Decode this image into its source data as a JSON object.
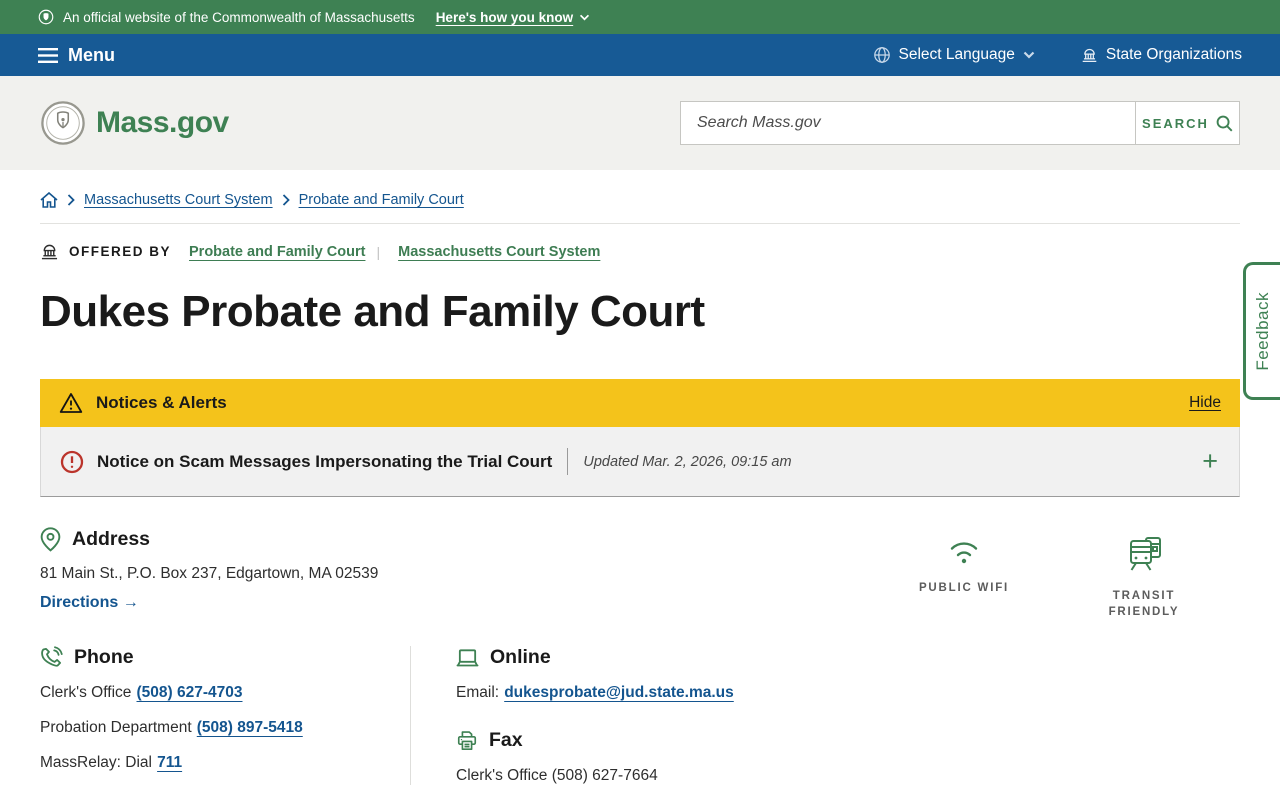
{
  "banner": {
    "official_text": "An official website of the Commonwealth of Massachusetts",
    "how_you_know": "Here's how you know"
  },
  "nav": {
    "menu_label": "Menu",
    "select_language_label": "Select Language",
    "state_organizations_label": "State Organizations"
  },
  "header": {
    "logo_text": "Mass.gov",
    "search_placeholder": "Search Mass.gov",
    "search_button_label": "SEARCH"
  },
  "breadcrumb": {
    "links": [
      {
        "label": "Massachusetts Court System"
      },
      {
        "label": "Probate and Family Court"
      }
    ]
  },
  "offered_by": {
    "label": "OFFERED BY",
    "links": [
      {
        "label": "Probate and Family Court"
      },
      {
        "label": "Massachusetts Court System"
      }
    ]
  },
  "page_title": "Dukes Probate and Family Court",
  "alerts": {
    "header_label": "Notices & Alerts",
    "hide_label": "Hide",
    "notice_title": "Notice on Scam Messages Impersonating the Trial Court",
    "notice_updated": "Updated Mar. 2, 2026, 09:15 am",
    "expand_glyph": "+"
  },
  "address": {
    "heading": "Address",
    "text": "81 Main St., P.O. Box 237, Edgartown, MA 02539",
    "directions_label": "Directions →"
  },
  "features": {
    "wifi_label": "PUBLIC WIFI",
    "transit_label": "TRANSIT FRIENDLY"
  },
  "phone": {
    "heading": "Phone",
    "rows": [
      {
        "label": "Clerk's Office",
        "link": "(508) 627-4703"
      },
      {
        "label": "Probation Department",
        "link": "(508) 897-5418"
      },
      {
        "label": "MassRelay: Dial",
        "link": "711"
      }
    ]
  },
  "online": {
    "heading": "Online",
    "email_label": "Email:",
    "email_link": "dukesprobate@jud.state.ma.us"
  },
  "fax": {
    "heading": "Fax",
    "text": "Clerk's Office (508) 627-7664"
  },
  "feedback_label": "Feedback",
  "colors": {
    "banner_green": "#3E8153",
    "nav_blue": "#175A95",
    "link_blue": "#14558F",
    "offered_link_green": "#3E7D53",
    "alert_yellow": "#F4C31B",
    "alert_red": "#BB342B",
    "brand_green": "#3E8153"
  }
}
